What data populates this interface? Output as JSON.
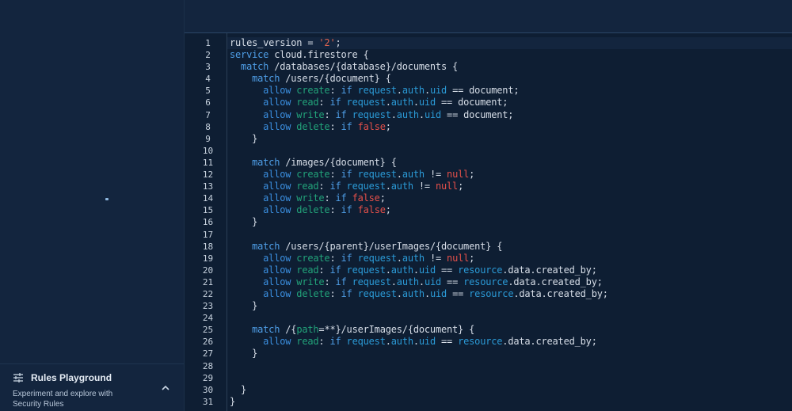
{
  "sidebar": {
    "playground": {
      "title": "Rules Playground",
      "description": "Experiment and explore with Security Rules",
      "icon": "sliders-icon",
      "chevron": "chevron-up-icon"
    }
  },
  "editor": {
    "line_numbers": [
      "1",
      "2",
      "3",
      "4",
      "5",
      "6",
      "7",
      "8",
      "9",
      "10",
      "11",
      "12",
      "13",
      "14",
      "15",
      "16",
      "17",
      "18",
      "19",
      "20",
      "21",
      "22",
      "23",
      "24",
      "25",
      "26",
      "27",
      "28",
      "29",
      "30",
      "31"
    ],
    "lines": [
      [
        {
          "t": "rules_version = ",
          "c": "plain"
        },
        {
          "t": "'2'",
          "c": "str"
        },
        {
          "t": ";",
          "c": "plain"
        }
      ],
      [
        {
          "t": "service",
          "c": "kw"
        },
        {
          "t": " cloud.firestore {",
          "c": "plain"
        }
      ],
      [
        {
          "t": "  match",
          "c": "kw"
        },
        {
          "t": " /databases/{database}/documents {",
          "c": "plain"
        }
      ],
      [
        {
          "t": "    match",
          "c": "kw"
        },
        {
          "t": " /users/{document} {",
          "c": "plain"
        }
      ],
      [
        {
          "t": "      allow",
          "c": "allow"
        },
        {
          "t": " create",
          "c": "perm"
        },
        {
          "t": ": ",
          "c": "plain"
        },
        {
          "t": "if",
          "c": "kw"
        },
        {
          "t": " request",
          "c": "var"
        },
        {
          "t": ".",
          "c": "plain"
        },
        {
          "t": "auth",
          "c": "var"
        },
        {
          "t": ".",
          "c": "plain"
        },
        {
          "t": "uid",
          "c": "var"
        },
        {
          "t": " == document;",
          "c": "plain"
        }
      ],
      [
        {
          "t": "      allow",
          "c": "allow"
        },
        {
          "t": " read",
          "c": "perm"
        },
        {
          "t": ": ",
          "c": "plain"
        },
        {
          "t": "if",
          "c": "kw"
        },
        {
          "t": " request",
          "c": "var"
        },
        {
          "t": ".",
          "c": "plain"
        },
        {
          "t": "auth",
          "c": "var"
        },
        {
          "t": ".",
          "c": "plain"
        },
        {
          "t": "uid",
          "c": "var"
        },
        {
          "t": " == document;",
          "c": "plain"
        }
      ],
      [
        {
          "t": "      allow",
          "c": "allow"
        },
        {
          "t": " write",
          "c": "perm"
        },
        {
          "t": ": ",
          "c": "plain"
        },
        {
          "t": "if",
          "c": "kw"
        },
        {
          "t": " request",
          "c": "var"
        },
        {
          "t": ".",
          "c": "plain"
        },
        {
          "t": "auth",
          "c": "var"
        },
        {
          "t": ".",
          "c": "plain"
        },
        {
          "t": "uid",
          "c": "var"
        },
        {
          "t": " == document;",
          "c": "plain"
        }
      ],
      [
        {
          "t": "      allow",
          "c": "allow"
        },
        {
          "t": " delete",
          "c": "perm"
        },
        {
          "t": ": ",
          "c": "plain"
        },
        {
          "t": "if",
          "c": "kw"
        },
        {
          "t": " false",
          "c": "bool"
        },
        {
          "t": ";",
          "c": "plain"
        }
      ],
      [
        {
          "t": "    }",
          "c": "plain"
        }
      ],
      [
        {
          "t": "",
          "c": "plain"
        }
      ],
      [
        {
          "t": "    match",
          "c": "kw"
        },
        {
          "t": " /images/{document} {",
          "c": "plain"
        }
      ],
      [
        {
          "t": "      allow",
          "c": "allow"
        },
        {
          "t": " create",
          "c": "perm"
        },
        {
          "t": ": ",
          "c": "plain"
        },
        {
          "t": "if",
          "c": "kw"
        },
        {
          "t": " request",
          "c": "var"
        },
        {
          "t": ".",
          "c": "plain"
        },
        {
          "t": "auth",
          "c": "var"
        },
        {
          "t": " != ",
          "c": "plain"
        },
        {
          "t": "null",
          "c": "bool"
        },
        {
          "t": ";",
          "c": "plain"
        }
      ],
      [
        {
          "t": "      allow",
          "c": "allow"
        },
        {
          "t": " read",
          "c": "perm"
        },
        {
          "t": ": ",
          "c": "plain"
        },
        {
          "t": "if",
          "c": "kw"
        },
        {
          "t": " request",
          "c": "var"
        },
        {
          "t": ".",
          "c": "plain"
        },
        {
          "t": "auth",
          "c": "var"
        },
        {
          "t": " != ",
          "c": "plain"
        },
        {
          "t": "null",
          "c": "bool"
        },
        {
          "t": ";",
          "c": "plain"
        }
      ],
      [
        {
          "t": "      allow",
          "c": "allow"
        },
        {
          "t": " write",
          "c": "perm"
        },
        {
          "t": ": ",
          "c": "plain"
        },
        {
          "t": "if",
          "c": "kw"
        },
        {
          "t": " false",
          "c": "bool"
        },
        {
          "t": ";",
          "c": "plain"
        }
      ],
      [
        {
          "t": "      allow",
          "c": "allow"
        },
        {
          "t": " delete",
          "c": "perm"
        },
        {
          "t": ": ",
          "c": "plain"
        },
        {
          "t": "if",
          "c": "kw"
        },
        {
          "t": " false",
          "c": "bool"
        },
        {
          "t": ";",
          "c": "plain"
        }
      ],
      [
        {
          "t": "    }",
          "c": "plain"
        }
      ],
      [
        {
          "t": "",
          "c": "plain"
        }
      ],
      [
        {
          "t": "    match",
          "c": "kw"
        },
        {
          "t": " /users/{parent}/userImages/{document} {",
          "c": "plain"
        }
      ],
      [
        {
          "t": "      allow",
          "c": "allow"
        },
        {
          "t": " create",
          "c": "perm"
        },
        {
          "t": ": ",
          "c": "plain"
        },
        {
          "t": "if",
          "c": "kw"
        },
        {
          "t": " request",
          "c": "var"
        },
        {
          "t": ".",
          "c": "plain"
        },
        {
          "t": "auth",
          "c": "var"
        },
        {
          "t": " != ",
          "c": "plain"
        },
        {
          "t": "null",
          "c": "bool"
        },
        {
          "t": ";",
          "c": "plain"
        }
      ],
      [
        {
          "t": "      allow",
          "c": "allow"
        },
        {
          "t": " read",
          "c": "perm"
        },
        {
          "t": ": ",
          "c": "plain"
        },
        {
          "t": "if",
          "c": "kw"
        },
        {
          "t": " request",
          "c": "var"
        },
        {
          "t": ".",
          "c": "plain"
        },
        {
          "t": "auth",
          "c": "var"
        },
        {
          "t": ".",
          "c": "plain"
        },
        {
          "t": "uid",
          "c": "var"
        },
        {
          "t": " == ",
          "c": "plain"
        },
        {
          "t": "resource",
          "c": "var"
        },
        {
          "t": ".data.created_by;",
          "c": "plain"
        }
      ],
      [
        {
          "t": "      allow",
          "c": "allow"
        },
        {
          "t": " write",
          "c": "perm"
        },
        {
          "t": ": ",
          "c": "plain"
        },
        {
          "t": "if",
          "c": "kw"
        },
        {
          "t": " request",
          "c": "var"
        },
        {
          "t": ".",
          "c": "plain"
        },
        {
          "t": "auth",
          "c": "var"
        },
        {
          "t": ".",
          "c": "plain"
        },
        {
          "t": "uid",
          "c": "var"
        },
        {
          "t": " == ",
          "c": "plain"
        },
        {
          "t": "resource",
          "c": "var"
        },
        {
          "t": ".data.created_by;",
          "c": "plain"
        }
      ],
      [
        {
          "t": "      allow",
          "c": "allow"
        },
        {
          "t": " delete",
          "c": "perm"
        },
        {
          "t": ": ",
          "c": "plain"
        },
        {
          "t": "if",
          "c": "kw"
        },
        {
          "t": " request",
          "c": "var"
        },
        {
          "t": ".",
          "c": "plain"
        },
        {
          "t": "auth",
          "c": "var"
        },
        {
          "t": ".",
          "c": "plain"
        },
        {
          "t": "uid",
          "c": "var"
        },
        {
          "t": " == ",
          "c": "plain"
        },
        {
          "t": "resource",
          "c": "var"
        },
        {
          "t": ".data.created_by;",
          "c": "plain"
        }
      ],
      [
        {
          "t": "    }",
          "c": "plain"
        }
      ],
      [
        {
          "t": "",
          "c": "plain"
        }
      ],
      [
        {
          "t": "    match",
          "c": "kw"
        },
        {
          "t": " /{",
          "c": "plain"
        },
        {
          "t": "path",
          "c": "perm"
        },
        {
          "t": "=**}/userImages/{document} {",
          "c": "plain"
        }
      ],
      [
        {
          "t": "      allow",
          "c": "allow"
        },
        {
          "t": " read",
          "c": "perm"
        },
        {
          "t": ": ",
          "c": "plain"
        },
        {
          "t": "if",
          "c": "kw"
        },
        {
          "t": " request",
          "c": "var"
        },
        {
          "t": ".",
          "c": "plain"
        },
        {
          "t": "auth",
          "c": "var"
        },
        {
          "t": ".",
          "c": "plain"
        },
        {
          "t": "uid",
          "c": "var"
        },
        {
          "t": " == ",
          "c": "plain"
        },
        {
          "t": "resource",
          "c": "var"
        },
        {
          "t": ".data.created_by;",
          "c": "plain"
        }
      ],
      [
        {
          "t": "    }",
          "c": "plain"
        }
      ],
      [
        {
          "t": "",
          "c": "plain"
        }
      ],
      [
        {
          "t": "",
          "c": "plain"
        }
      ],
      [
        {
          "t": "  }",
          "c": "plain"
        }
      ],
      [
        {
          "t": "}",
          "c": "plain"
        }
      ]
    ],
    "current_line": 1
  },
  "colors": {
    "keyword": "#4f9fe8",
    "permission": "#22a37a",
    "variable": "#2b9ad6",
    "string": "#e0644f",
    "literal": "#e5504a",
    "background": "#0e1e33",
    "sidebar": "#13253e"
  }
}
